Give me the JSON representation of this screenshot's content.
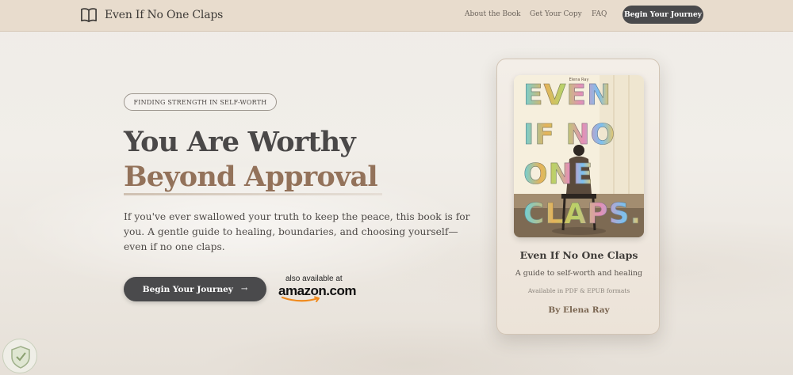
{
  "brand": {
    "name": "Even If No One Claps"
  },
  "nav": {
    "links": [
      {
        "label": "About the Book"
      },
      {
        "label": "Get Your Copy"
      },
      {
        "label": "FAQ"
      }
    ],
    "cta_label": "Begin Your Journey"
  },
  "hero": {
    "eyebrow": "FINDING STRENGTH IN SELF-WORTH",
    "headline_line1": "You Are Worthy",
    "headline_line2": "Beyond Approval",
    "lead": "If you've ever swallowed your truth to keep the peace, this book is for you. A gentle guide to healing, boundaries, and choosing yourself—even if no one claps.",
    "cta_label": "Begin Your Journey",
    "cta_arrow": "→",
    "also_available": "also available at",
    "amazon_logo": "amazon.com"
  },
  "book_card": {
    "cover_small_text": "Elena Ray",
    "cover_words": [
      "EVEN",
      "IF NO",
      "ONE",
      "CLAPS."
    ],
    "title": "Even If No One Claps",
    "subtitle": "A guide to self-worth and healing",
    "formats": "Available in PDF & EPUB formats",
    "author": "By Elena Ray"
  },
  "icons": {
    "brand": "open-book-icon",
    "cta_arrow": "arrow-right-icon",
    "amazon_smile": "amazon-smile-icon",
    "corner_badge": "shield-badge-icon"
  },
  "colors": {
    "nav_bg": "#e8dccd",
    "dark_button": "#4a4a4c",
    "accent_brown": "#93725a",
    "headline_gray": "#4a4848"
  }
}
